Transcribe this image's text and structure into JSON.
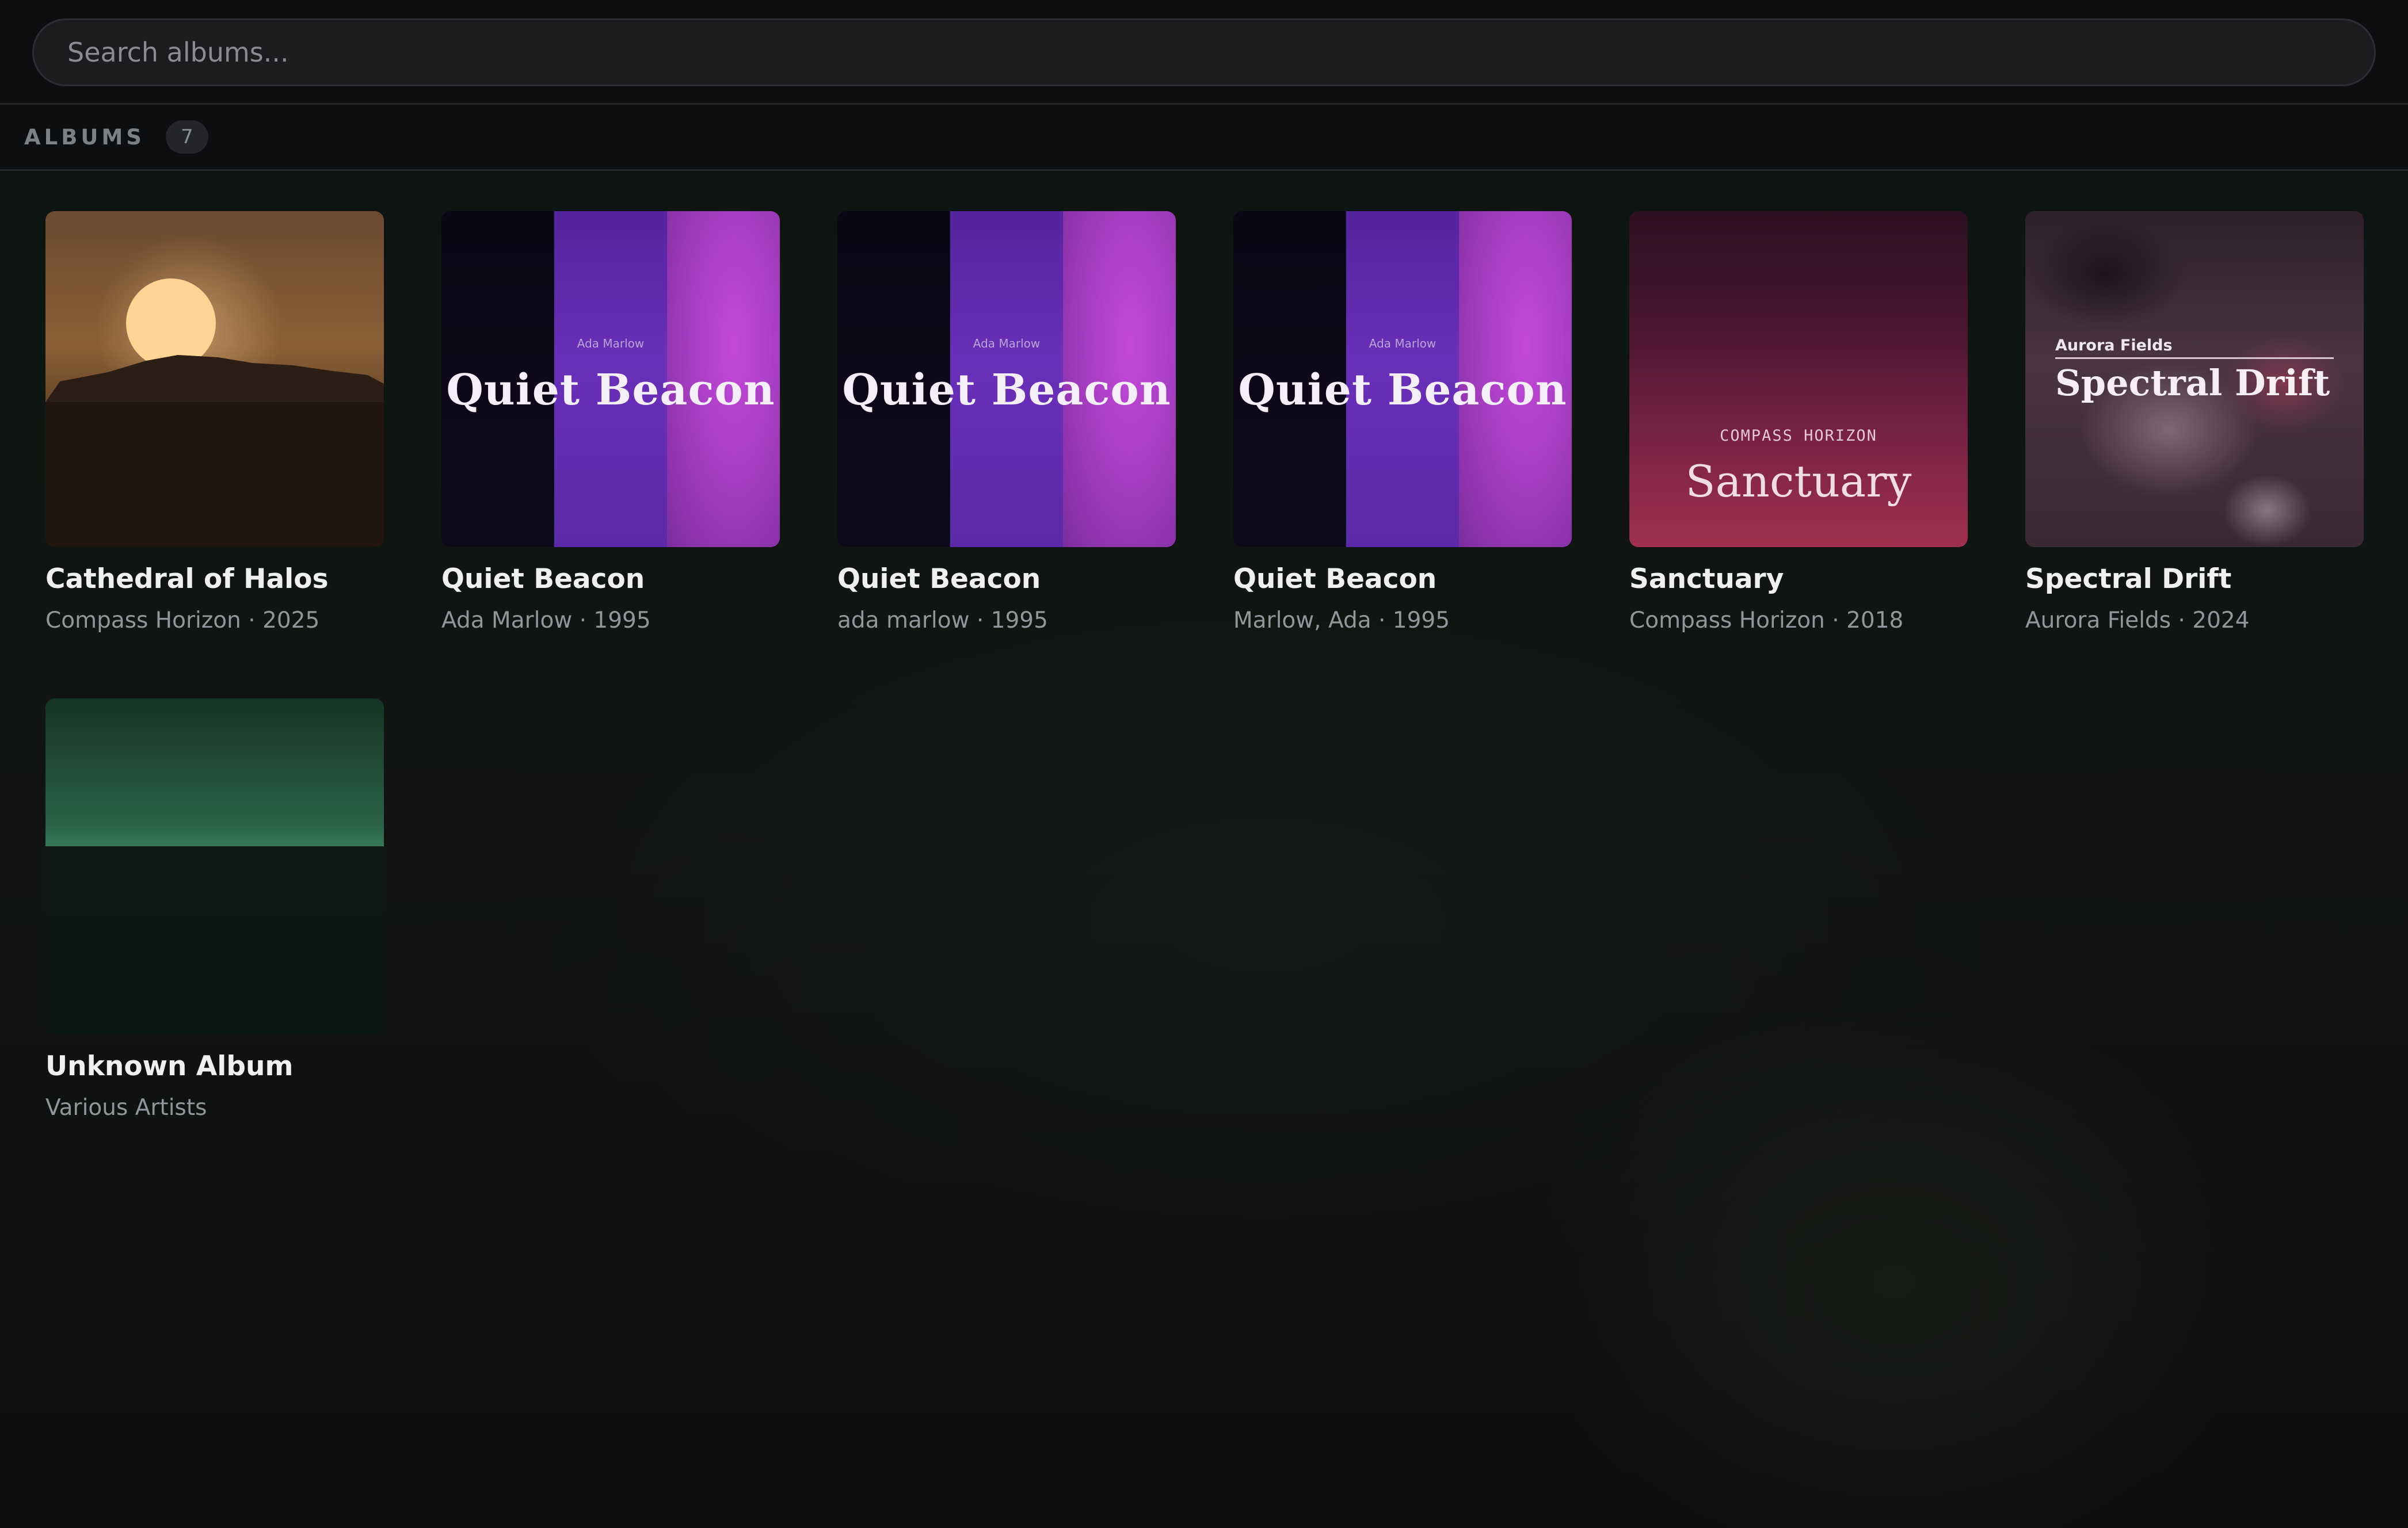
{
  "search": {
    "placeholder": "Search albums..."
  },
  "section": {
    "title": "ALBUMS",
    "count": "7"
  },
  "albums": [
    {
      "title": "Cathedral of Halos",
      "subtitle": "Compass Horizon · 2025"
    },
    {
      "title": "Quiet Beacon",
      "subtitle": "Ada Marlow · 1995",
      "cover_artist": "Ada Marlow",
      "cover_title": "Quiet Beacon"
    },
    {
      "title": "Quiet Beacon",
      "subtitle": "ada marlow · 1995",
      "cover_artist": "Ada Marlow",
      "cover_title": "Quiet Beacon"
    },
    {
      "title": "Quiet Beacon",
      "subtitle": "Marlow, Ada · 1995",
      "cover_artist": "Ada Marlow",
      "cover_title": "Quiet Beacon"
    },
    {
      "title": "Sanctuary",
      "subtitle": "Compass Horizon · 2018",
      "cover_artist": "COMPASS HORIZON",
      "cover_title": "Sanctuary"
    },
    {
      "title": "Spectral Drift",
      "subtitle": "Aurora Fields · 2024",
      "cover_artist": "Aurora Fields",
      "cover_title": "Spectral Drift"
    },
    {
      "title": "Unknown Album",
      "subtitle": "Various Artists"
    }
  ],
  "colors": {
    "background": "#0e1010",
    "topbar": "#0d0e10",
    "search_bg": "#1b1c1e",
    "text_primary": "#f0f0f0",
    "text_secondary": "#92959a"
  }
}
